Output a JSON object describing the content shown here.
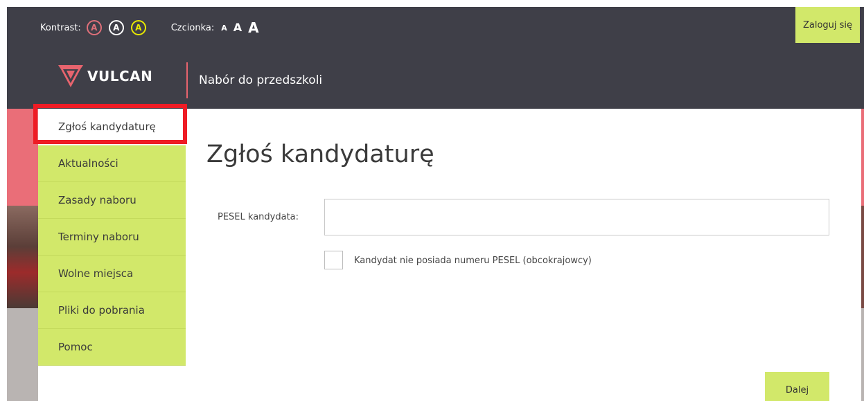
{
  "accessibility": {
    "contrast_label": "Kontrast:",
    "contrast_options": [
      "A",
      "A",
      "A"
    ],
    "font_label": "Czcionka:",
    "font_sizes": [
      "A",
      "A",
      "A"
    ]
  },
  "header": {
    "login_label": "Zaloguj się",
    "logo_text": "VULCAN",
    "app_title": "Nabór do przedszkoli"
  },
  "nav": {
    "items": [
      {
        "label": "Zgłoś kandydaturę",
        "active": true
      },
      {
        "label": "Aktualności"
      },
      {
        "label": "Zasady naboru"
      },
      {
        "label": "Terminy naboru"
      },
      {
        "label": "Wolne miejsca"
      },
      {
        "label": "Pliki do pobrania"
      },
      {
        "label": "Pomoc"
      }
    ]
  },
  "main": {
    "title": "Zgłoś kandydaturę",
    "pesel_label": "PESEL kandydata:",
    "pesel_value": "",
    "no_pesel_label": "Kandydat nie posiada numeru PESEL (obcokrajowcy)",
    "next_label": "Dalej"
  },
  "colors": {
    "header_bg": "#3f3f48",
    "accent_green": "#d2e86a",
    "highlight_red": "#ee1c25",
    "brand_red": "#e8646e"
  }
}
